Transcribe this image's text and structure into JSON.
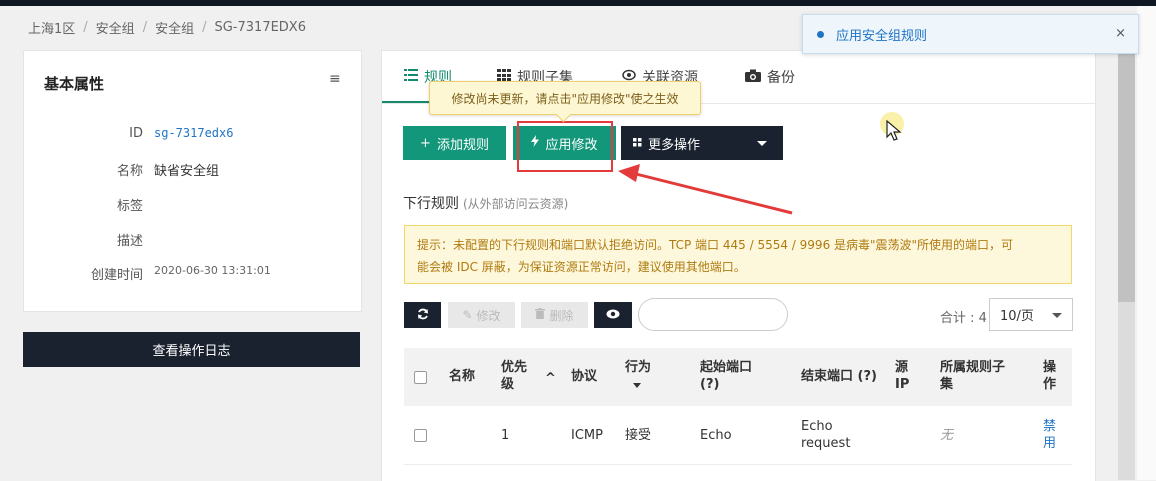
{
  "breadcrumb": {
    "items": [
      "上海1区",
      "安全组",
      "安全组",
      "SG-7317EDX6"
    ],
    "separator": "/"
  },
  "basic": {
    "title": "基本属性",
    "menu_icon": "≡",
    "rows": [
      {
        "label": "ID",
        "value": "sg-7317edx6"
      },
      {
        "label": "名称",
        "value": "缺省安全组"
      },
      {
        "label": "标签",
        "value": ""
      },
      {
        "label": "描述",
        "value": ""
      },
      {
        "label": "创建时间",
        "value": "2020-06-30 13:31:01"
      }
    ]
  },
  "log_button": "查看操作日志",
  "tabs": [
    {
      "label": "规则",
      "icon": "list-icon"
    },
    {
      "label": "规则子集",
      "icon": "grid-icon"
    },
    {
      "label": "关联资源",
      "icon": "eye-icon"
    },
    {
      "label": "备份",
      "icon": "camera-icon"
    }
  ],
  "tooltip": "修改尚未更新，请点击\"应用修改\"使之生效",
  "actions": {
    "add_rule": "添加规则",
    "apply_changes": "应用修改",
    "more_actions": "更多操作"
  },
  "section": {
    "title": "下行规则",
    "hint": "(从外部访问云资源)"
  },
  "warning": {
    "line1": "提示：未配置的下行规则和端口默认拒绝访问。TCP 端口 445 / 5554 / 9996 是病毒\"震荡波\"所使用的端口，可",
    "line2": "能会被 IDC 屏蔽，为保证资源正常访问，建议使用其他端口。"
  },
  "toolbar": {
    "edit": "修改",
    "delete": "删除",
    "search_placeholder": ""
  },
  "pagination": {
    "total_label": "合计 : 4",
    "page_size": "10/页"
  },
  "table": {
    "headers": {
      "name": "名称",
      "priority_1": "优先",
      "priority_2": "级",
      "sort": "^",
      "protocol": "协议",
      "action": "行为",
      "start_port_1": "起始端口",
      "start_port_2": "(?)",
      "end_port": "结束端口 (?)",
      "source_ip_1": "源",
      "source_ip_2": "IP",
      "subset_1": "所属规则子",
      "subset_2": "集",
      "ops_1": "操",
      "ops_2": "作"
    },
    "rows": [
      {
        "name": "",
        "priority": "1",
        "protocol": "ICMP",
        "action": "接受",
        "start_port": "Echo",
        "end_port_1": "Echo",
        "end_port_2": "request",
        "source_ip": "",
        "subset": "无",
        "op_1": "禁",
        "op_2": "用"
      }
    ]
  },
  "notification": {
    "text": "应用安全组规则",
    "close": "×"
  },
  "colors": {
    "primary_green": "#13977a",
    "dark": "#1a2230",
    "link_blue": "#1e74c6",
    "annotation_red": "#e33b3b"
  }
}
